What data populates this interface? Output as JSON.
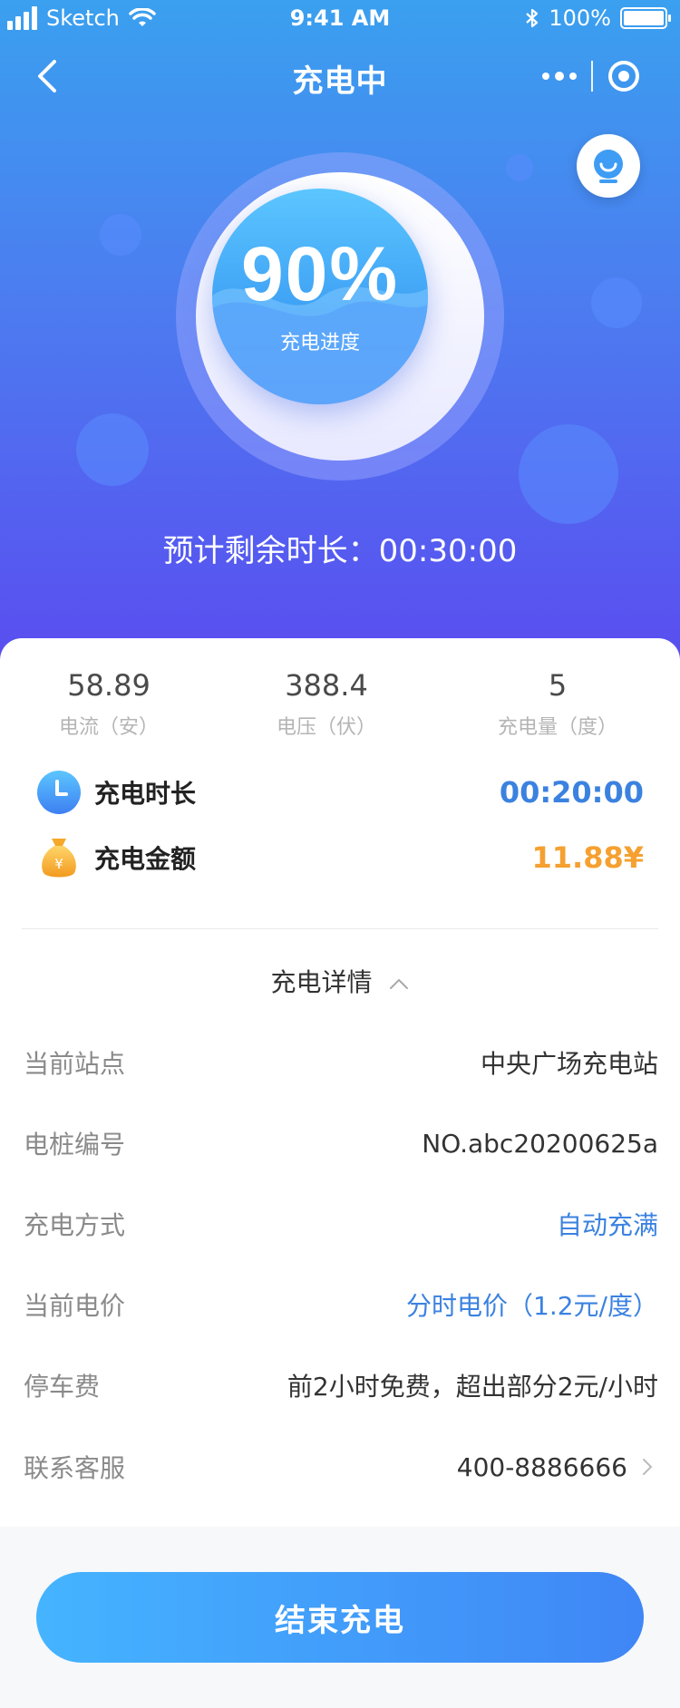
{
  "status_bar": {
    "carrier": "Sketch",
    "time": "9:41 AM",
    "battery_pct": "100%"
  },
  "nav": {
    "title": "充电中"
  },
  "progress": {
    "percent_text": "90%",
    "percent_value": 0.9,
    "label": "充电进度",
    "remaining_label": "预计剩余时长：",
    "remaining_value": "00:30:00"
  },
  "stats": [
    {
      "value": "58.89",
      "label": "电流（安）"
    },
    {
      "value": "388.4",
      "label": "电压（伏）"
    },
    {
      "value": "5",
      "label": "充电量（度）"
    }
  ],
  "charge_time": {
    "label": "充电时长",
    "value": "00:20:00"
  },
  "charge_amount": {
    "label": "充电金额",
    "value": "11.88¥"
  },
  "details": {
    "title": "充电详情",
    "rows": [
      {
        "label": "当前站点",
        "value": "中央广场充电站"
      },
      {
        "label": "电桩编号",
        "value": "NO.abc20200625a"
      },
      {
        "label": "充电方式",
        "value": "自动充满"
      },
      {
        "label": "当前电价",
        "value": "分时电价（1.2元/度）"
      },
      {
        "label": "停车费",
        "value": "前2小时免费，超出部分2元/小时"
      },
      {
        "label": "联系客服",
        "value": "400-8886666"
      }
    ]
  },
  "end_button": {
    "label": "结束充电"
  },
  "colors": {
    "accent_blue": "#3b82e0",
    "accent_orange": "#f5a030",
    "gradient_top": "#3aa0ef",
    "gradient_bottom": "#5a4cf0"
  }
}
